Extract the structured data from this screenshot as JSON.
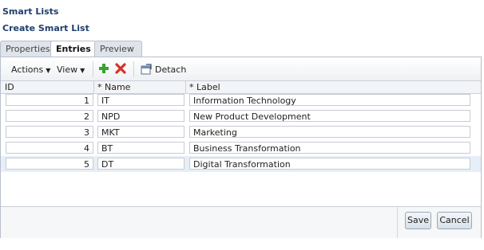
{
  "breadcrumb": {
    "level1": "Smart Lists",
    "level2": "Create Smart List"
  },
  "tabs": [
    {
      "label": "Properties",
      "active": false
    },
    {
      "label": "Entries",
      "active": true
    },
    {
      "label": "Preview",
      "active": false
    }
  ],
  "toolbar": {
    "actions_label": "Actions",
    "view_label": "View",
    "detach_label": "Detach"
  },
  "columns": {
    "id": "ID",
    "name": "* Name",
    "label": "* Label"
  },
  "rows": [
    {
      "id": "1",
      "name": "IT",
      "label": "Information Technology"
    },
    {
      "id": "2",
      "name": "NPD",
      "label": "New Product Development"
    },
    {
      "id": "3",
      "name": "MKT",
      "label": "Marketing"
    },
    {
      "id": "4",
      "name": "BT",
      "label": "Business Transformation"
    },
    {
      "id": "5",
      "name": "DT",
      "label": "Digital Transformation"
    }
  ],
  "selected_row": 4,
  "buttons": {
    "save": "Save",
    "cancel": "Cancel"
  },
  "colors": {
    "accent_text": "#1f3f6b",
    "add_icon": "#3aa32e",
    "delete_icon": "#d93025"
  }
}
